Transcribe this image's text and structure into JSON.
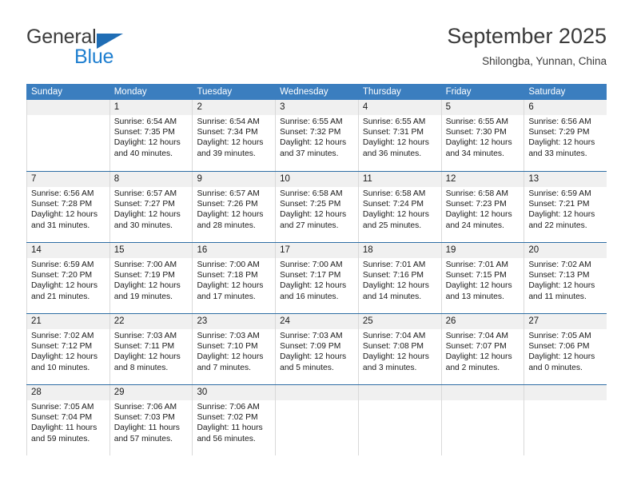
{
  "brand": {
    "name_top": "General",
    "name_bottom": "Blue",
    "triangle_color": "#1f6db5",
    "blue_color": "#1f7fd0"
  },
  "header": {
    "title": "September 2025",
    "subtitle": "Shilongba, Yunnan, China"
  },
  "theme": {
    "header_bg": "#3b7ebf",
    "row_divider": "#2e6da4",
    "daynum_band": "#f0f0f0",
    "cell_divider": "#d9d9d9"
  },
  "weekdays": [
    "Sunday",
    "Monday",
    "Tuesday",
    "Wednesday",
    "Thursday",
    "Friday",
    "Saturday"
  ],
  "weeks": [
    [
      {
        "day": "",
        "sunrise": "",
        "sunset": "",
        "daylight1": "",
        "daylight2": "",
        "empty": true
      },
      {
        "day": "1",
        "sunrise": "Sunrise: 6:54 AM",
        "sunset": "Sunset: 7:35 PM",
        "daylight1": "Daylight: 12 hours",
        "daylight2": "and 40 minutes."
      },
      {
        "day": "2",
        "sunrise": "Sunrise: 6:54 AM",
        "sunset": "Sunset: 7:34 PM",
        "daylight1": "Daylight: 12 hours",
        "daylight2": "and 39 minutes."
      },
      {
        "day": "3",
        "sunrise": "Sunrise: 6:55 AM",
        "sunset": "Sunset: 7:32 PM",
        "daylight1": "Daylight: 12 hours",
        "daylight2": "and 37 minutes."
      },
      {
        "day": "4",
        "sunrise": "Sunrise: 6:55 AM",
        "sunset": "Sunset: 7:31 PM",
        "daylight1": "Daylight: 12 hours",
        "daylight2": "and 36 minutes."
      },
      {
        "day": "5",
        "sunrise": "Sunrise: 6:55 AM",
        "sunset": "Sunset: 7:30 PM",
        "daylight1": "Daylight: 12 hours",
        "daylight2": "and 34 minutes."
      },
      {
        "day": "6",
        "sunrise": "Sunrise: 6:56 AM",
        "sunset": "Sunset: 7:29 PM",
        "daylight1": "Daylight: 12 hours",
        "daylight2": "and 33 minutes."
      }
    ],
    [
      {
        "day": "7",
        "sunrise": "Sunrise: 6:56 AM",
        "sunset": "Sunset: 7:28 PM",
        "daylight1": "Daylight: 12 hours",
        "daylight2": "and 31 minutes."
      },
      {
        "day": "8",
        "sunrise": "Sunrise: 6:57 AM",
        "sunset": "Sunset: 7:27 PM",
        "daylight1": "Daylight: 12 hours",
        "daylight2": "and 30 minutes."
      },
      {
        "day": "9",
        "sunrise": "Sunrise: 6:57 AM",
        "sunset": "Sunset: 7:26 PM",
        "daylight1": "Daylight: 12 hours",
        "daylight2": "and 28 minutes."
      },
      {
        "day": "10",
        "sunrise": "Sunrise: 6:58 AM",
        "sunset": "Sunset: 7:25 PM",
        "daylight1": "Daylight: 12 hours",
        "daylight2": "and 27 minutes."
      },
      {
        "day": "11",
        "sunrise": "Sunrise: 6:58 AM",
        "sunset": "Sunset: 7:24 PM",
        "daylight1": "Daylight: 12 hours",
        "daylight2": "and 25 minutes."
      },
      {
        "day": "12",
        "sunrise": "Sunrise: 6:58 AM",
        "sunset": "Sunset: 7:23 PM",
        "daylight1": "Daylight: 12 hours",
        "daylight2": "and 24 minutes."
      },
      {
        "day": "13",
        "sunrise": "Sunrise: 6:59 AM",
        "sunset": "Sunset: 7:21 PM",
        "daylight1": "Daylight: 12 hours",
        "daylight2": "and 22 minutes."
      }
    ],
    [
      {
        "day": "14",
        "sunrise": "Sunrise: 6:59 AM",
        "sunset": "Sunset: 7:20 PM",
        "daylight1": "Daylight: 12 hours",
        "daylight2": "and 21 minutes."
      },
      {
        "day": "15",
        "sunrise": "Sunrise: 7:00 AM",
        "sunset": "Sunset: 7:19 PM",
        "daylight1": "Daylight: 12 hours",
        "daylight2": "and 19 minutes."
      },
      {
        "day": "16",
        "sunrise": "Sunrise: 7:00 AM",
        "sunset": "Sunset: 7:18 PM",
        "daylight1": "Daylight: 12 hours",
        "daylight2": "and 17 minutes."
      },
      {
        "day": "17",
        "sunrise": "Sunrise: 7:00 AM",
        "sunset": "Sunset: 7:17 PM",
        "daylight1": "Daylight: 12 hours",
        "daylight2": "and 16 minutes."
      },
      {
        "day": "18",
        "sunrise": "Sunrise: 7:01 AM",
        "sunset": "Sunset: 7:16 PM",
        "daylight1": "Daylight: 12 hours",
        "daylight2": "and 14 minutes."
      },
      {
        "day": "19",
        "sunrise": "Sunrise: 7:01 AM",
        "sunset": "Sunset: 7:15 PM",
        "daylight1": "Daylight: 12 hours",
        "daylight2": "and 13 minutes."
      },
      {
        "day": "20",
        "sunrise": "Sunrise: 7:02 AM",
        "sunset": "Sunset: 7:13 PM",
        "daylight1": "Daylight: 12 hours",
        "daylight2": "and 11 minutes."
      }
    ],
    [
      {
        "day": "21",
        "sunrise": "Sunrise: 7:02 AM",
        "sunset": "Sunset: 7:12 PM",
        "daylight1": "Daylight: 12 hours",
        "daylight2": "and 10 minutes."
      },
      {
        "day": "22",
        "sunrise": "Sunrise: 7:03 AM",
        "sunset": "Sunset: 7:11 PM",
        "daylight1": "Daylight: 12 hours",
        "daylight2": "and 8 minutes."
      },
      {
        "day": "23",
        "sunrise": "Sunrise: 7:03 AM",
        "sunset": "Sunset: 7:10 PM",
        "daylight1": "Daylight: 12 hours",
        "daylight2": "and 7 minutes."
      },
      {
        "day": "24",
        "sunrise": "Sunrise: 7:03 AM",
        "sunset": "Sunset: 7:09 PM",
        "daylight1": "Daylight: 12 hours",
        "daylight2": "and 5 minutes."
      },
      {
        "day": "25",
        "sunrise": "Sunrise: 7:04 AM",
        "sunset": "Sunset: 7:08 PM",
        "daylight1": "Daylight: 12 hours",
        "daylight2": "and 3 minutes."
      },
      {
        "day": "26",
        "sunrise": "Sunrise: 7:04 AM",
        "sunset": "Sunset: 7:07 PM",
        "daylight1": "Daylight: 12 hours",
        "daylight2": "and 2 minutes."
      },
      {
        "day": "27",
        "sunrise": "Sunrise: 7:05 AM",
        "sunset": "Sunset: 7:06 PM",
        "daylight1": "Daylight: 12 hours",
        "daylight2": "and 0 minutes."
      }
    ],
    [
      {
        "day": "28",
        "sunrise": "Sunrise: 7:05 AM",
        "sunset": "Sunset: 7:04 PM",
        "daylight1": "Daylight: 11 hours",
        "daylight2": "and 59 minutes."
      },
      {
        "day": "29",
        "sunrise": "Sunrise: 7:06 AM",
        "sunset": "Sunset: 7:03 PM",
        "daylight1": "Daylight: 11 hours",
        "daylight2": "and 57 minutes."
      },
      {
        "day": "30",
        "sunrise": "Sunrise: 7:06 AM",
        "sunset": "Sunset: 7:02 PM",
        "daylight1": "Daylight: 11 hours",
        "daylight2": "and 56 minutes."
      },
      {
        "day": "",
        "sunrise": "",
        "sunset": "",
        "daylight1": "",
        "daylight2": "",
        "empty": true
      },
      {
        "day": "",
        "sunrise": "",
        "sunset": "",
        "daylight1": "",
        "daylight2": "",
        "empty": true
      },
      {
        "day": "",
        "sunrise": "",
        "sunset": "",
        "daylight1": "",
        "daylight2": "",
        "empty": true
      },
      {
        "day": "",
        "sunrise": "",
        "sunset": "",
        "daylight1": "",
        "daylight2": "",
        "empty": true
      }
    ]
  ]
}
